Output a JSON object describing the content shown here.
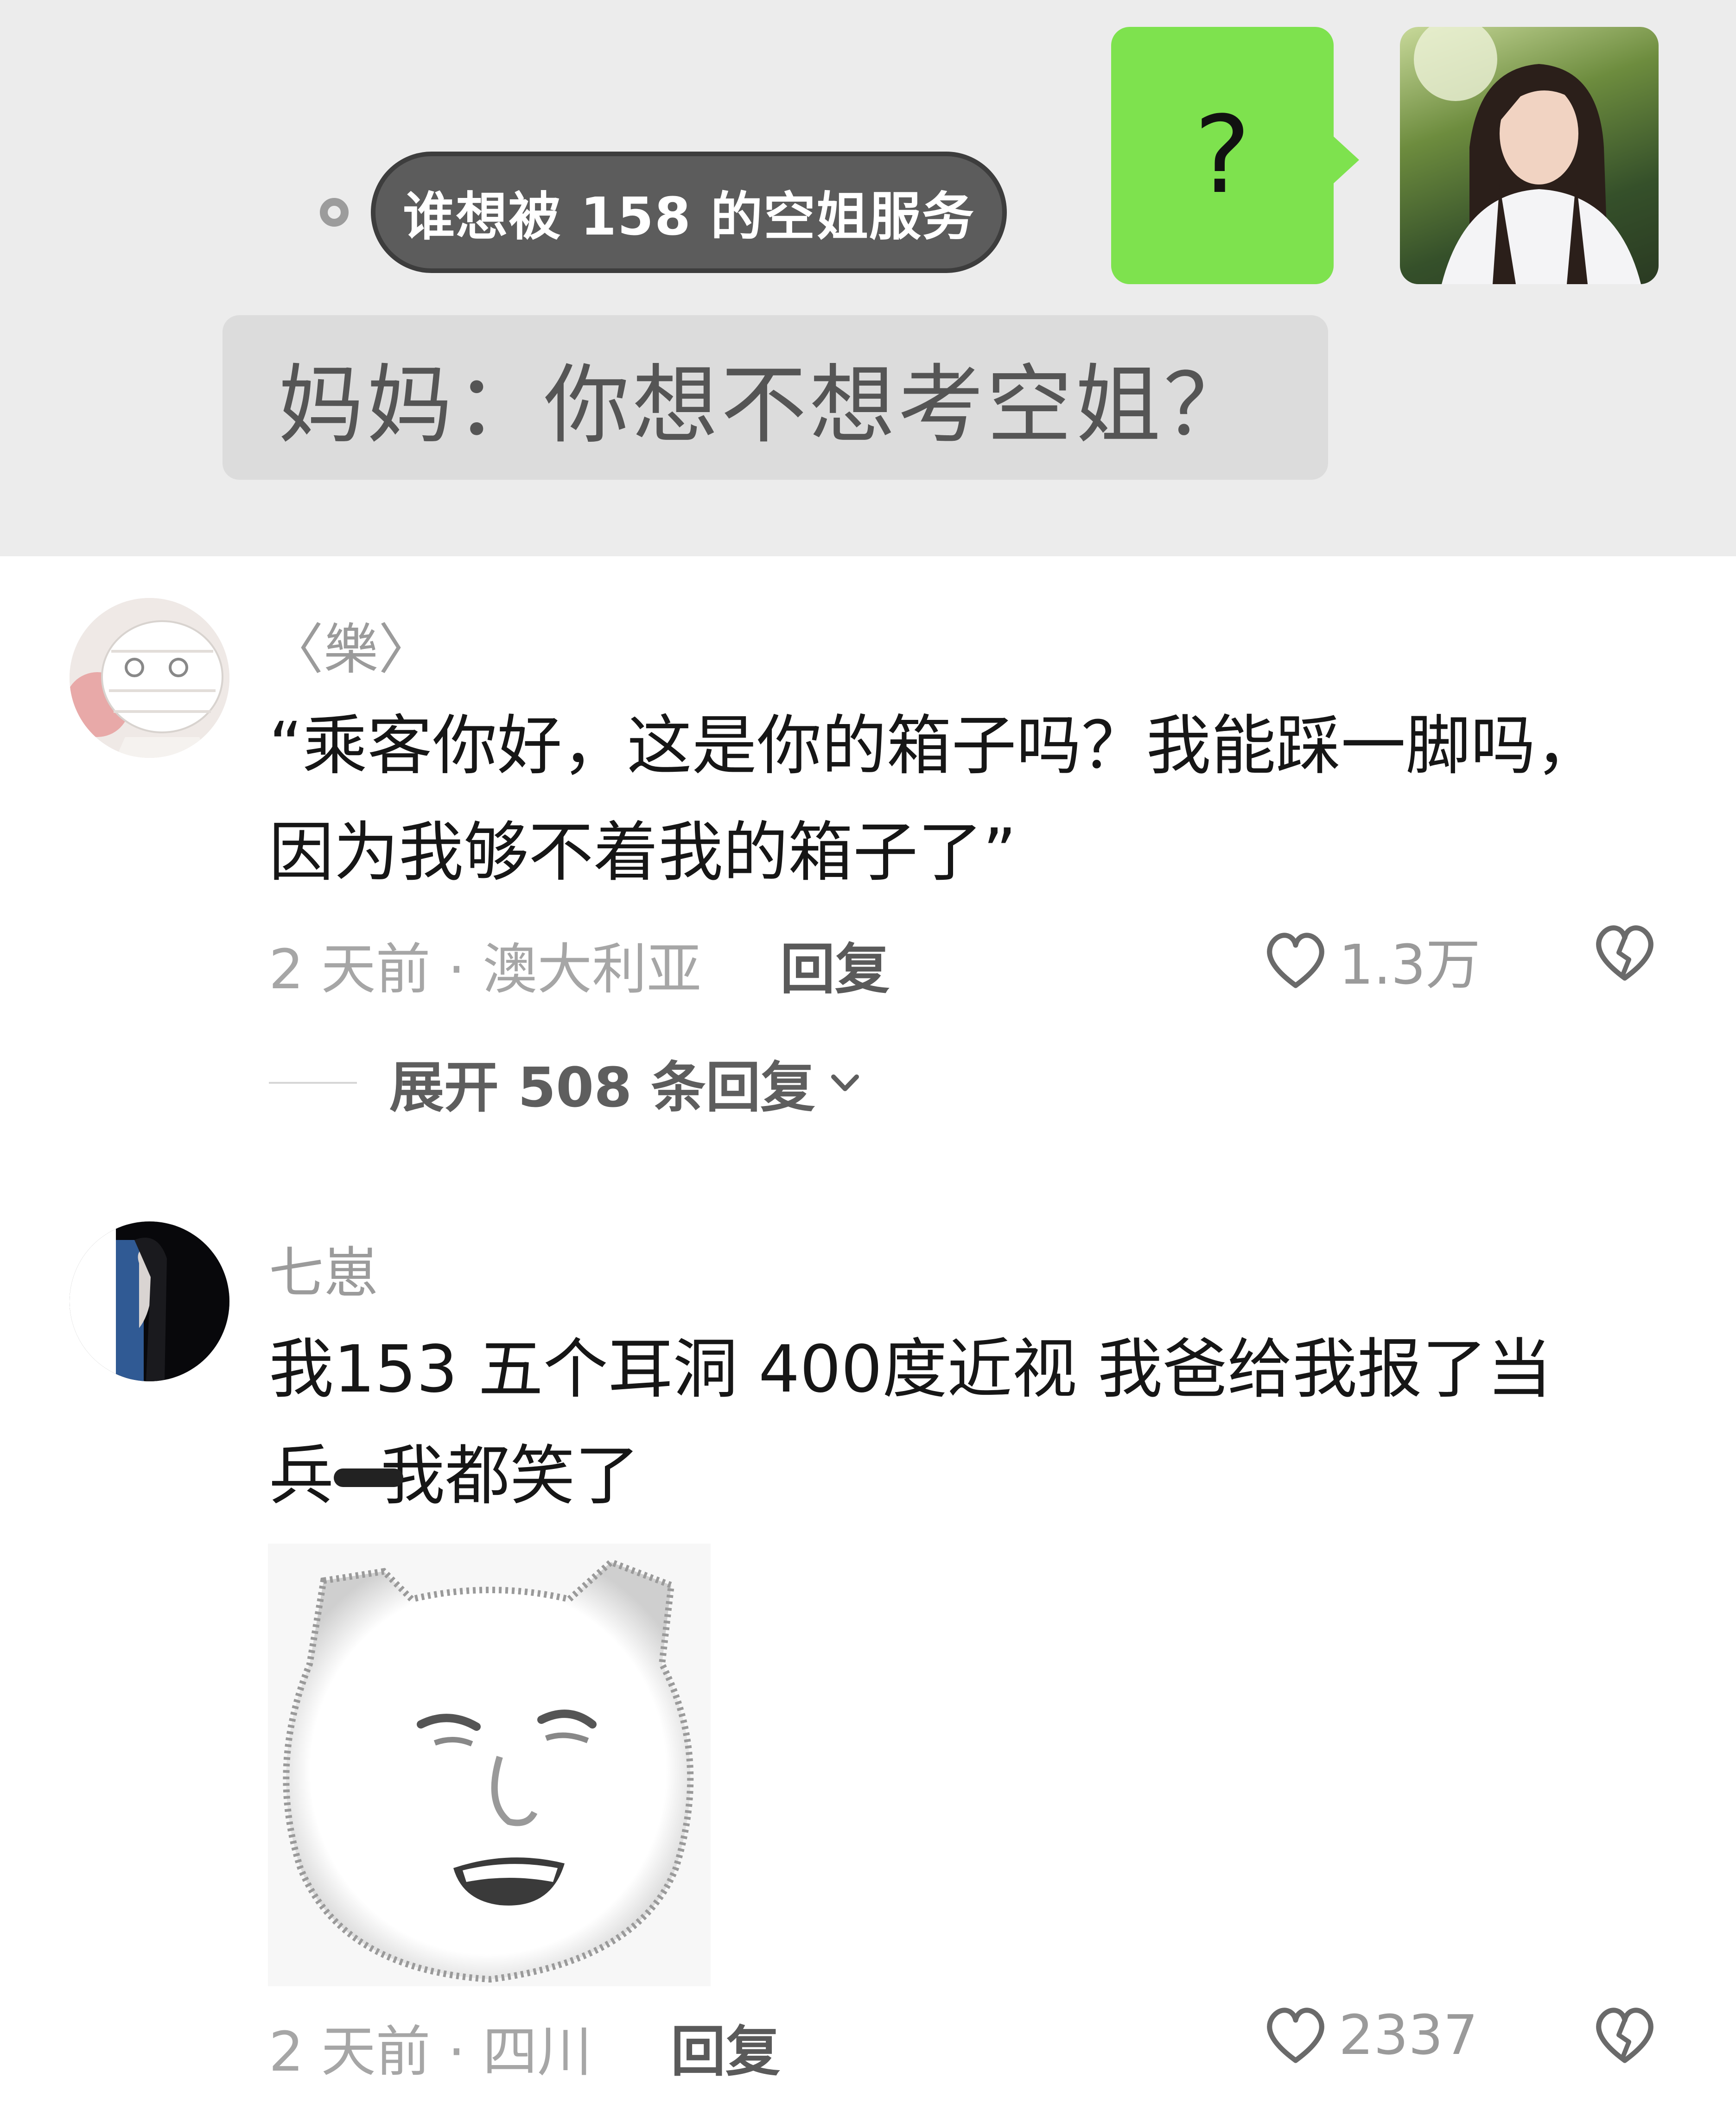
{
  "chat_screenshot": {
    "caption": "谁想被 158 的空姐服务",
    "bubble_text": "?",
    "quote": "妈妈：你想不想考空姐？"
  },
  "comments": [
    {
      "username": "〈樂〉",
      "text_line1": "“乘客你好，这是你的箱子吗？我能踩一脚吗，",
      "text_line2": "因为我够不着我的箱子了”",
      "meta": "2 天前 · 澳大利亚",
      "reply_label": "回复",
      "likes": "1.3万",
      "expand_label": "展开 508 条回复"
    },
    {
      "username": "七崽",
      "text_line1": "我153  五个耳洞  400度近视  我爸给我报了当",
      "text_line2": "兵",
      "text_line2_tail": "我都笑了",
      "meta": "2 天前 · 四川",
      "reply_label": "回复",
      "likes": "2337"
    }
  ],
  "icons": {
    "like": "heart-outline-icon",
    "dislike": "broken-heart-icon",
    "expand": "chevron-down-icon"
  },
  "colors": {
    "bubble_green": "#7ee24e",
    "text_primary": "#161616",
    "text_secondary": "#a6a6a6"
  }
}
